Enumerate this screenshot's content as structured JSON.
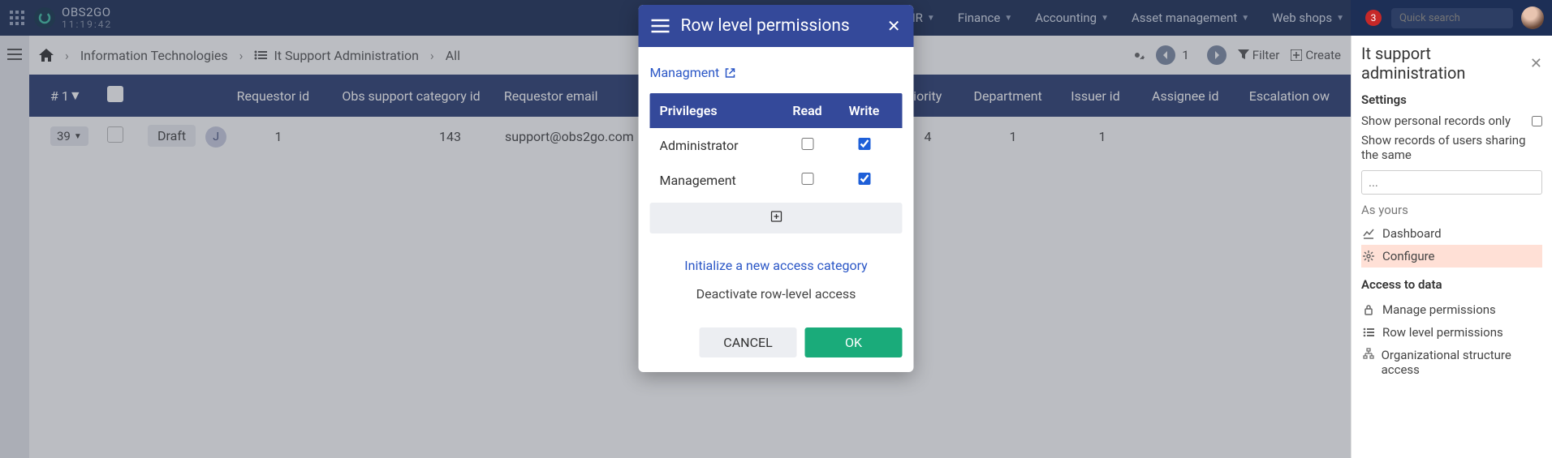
{
  "topnav": {
    "brand": "OBS2GO",
    "time": "11:19:42",
    "items": [
      "HR",
      "Finance",
      "Accounting",
      "Asset management",
      "Web shops"
    ],
    "notif_count": "3",
    "search_placeholder": "Quick search"
  },
  "breadcrumb": {
    "items": [
      "Information Technologies",
      "It Support Administration",
      "All"
    ]
  },
  "actionbar": {
    "page": "1",
    "filter": "Filter",
    "create": "Create"
  },
  "table": {
    "headers": {
      "id": "# 1",
      "requestor_id": "Requestor id",
      "category": "Obs support category id",
      "email": "Requestor email",
      "priority": "Priority",
      "department": "Department",
      "issuer": "Issuer id",
      "assignee": "Assignee id",
      "escalation": "Escalation ow"
    },
    "row": {
      "id": "39",
      "status": "Draft",
      "avatar_letter": "J",
      "requestor_id": "1",
      "category": "143",
      "email": "support@obs2go.com",
      "priority": "4",
      "department": "1",
      "issuer": "1",
      "assignee": ""
    }
  },
  "rightpanel": {
    "title": "It support administration",
    "settings_heading": "Settings",
    "show_personal": "Show personal records only",
    "show_sharing": "Show records of users sharing the same",
    "input_placeholder": "...",
    "as_yours": "As yours",
    "dashboard": "Dashboard",
    "configure": "Configure",
    "access_heading": "Access to data",
    "manage_perm": "Manage permissions",
    "row_level": "Row level permissions",
    "org_access": "Organizational structure access"
  },
  "modal": {
    "title": "Row level permissions",
    "management_link": "Managment",
    "col_priv": "Privileges",
    "col_read": "Read",
    "col_write": "Write",
    "rows": [
      {
        "name": "Administrator",
        "read": false,
        "write": true
      },
      {
        "name": "Management",
        "read": false,
        "write": true
      }
    ],
    "init_link": "Initialize a new access category",
    "deactivate": "Deactivate row-level access",
    "cancel": "CANCEL",
    "ok": "OK"
  }
}
